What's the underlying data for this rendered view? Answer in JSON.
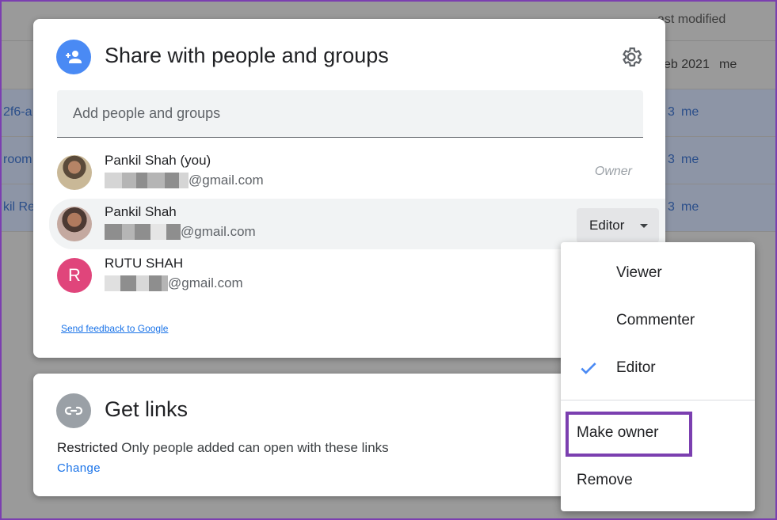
{
  "background": {
    "header_modified": "ast modified",
    "rows": [
      {
        "name": "",
        "date": "eb 2021",
        "owner": "me"
      },
      {
        "name": "2f6-a",
        "date": "3",
        "owner": "me"
      },
      {
        "name": "room",
        "date": "3",
        "owner": "me"
      },
      {
        "name": "kil Res",
        "date": "3",
        "owner": "me"
      }
    ]
  },
  "share": {
    "title": "Share with people and groups",
    "input_placeholder": "Add people and groups",
    "people": [
      {
        "name": "Pankil Shah (you)",
        "email_suffix": "@gmail.com",
        "role": "Owner"
      },
      {
        "name": "Pankil Shah",
        "email_suffix": "@gmail.com",
        "role": "Editor"
      },
      {
        "name": "RUTU SHAH",
        "initial": "R",
        "email_suffix": "@gmail.com"
      }
    ],
    "feedback_link": "Send feedback to Google"
  },
  "links": {
    "title": "Get links",
    "restricted_label": "Restricted",
    "restricted_desc": "Only people added can open with these links",
    "change_label": "Change"
  },
  "role_menu": {
    "items": [
      "Viewer",
      "Commenter",
      "Editor",
      "Make owner",
      "Remove"
    ],
    "selected": "Editor"
  },
  "colors": {
    "accent": "#1a73e8",
    "highlight_border": "#7b3fb0",
    "avatar_r": "#e0457b",
    "header_icon": "#4a8af4"
  }
}
